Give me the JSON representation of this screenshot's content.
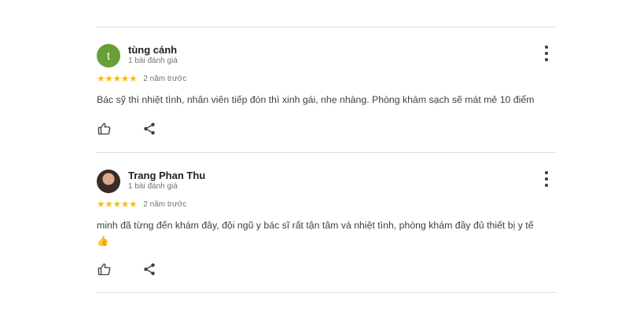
{
  "reviews": [
    {
      "reviewer_name": "tùng cánh",
      "avatar_letter": "t",
      "review_count": "1 bài đánh giá",
      "rating": 5,
      "stars": "★★★★★",
      "time": "2 năm trước",
      "text": "Bác sỹ thì nhiệt tình, nhân viên tiếp đón thì xinh gái, nhẹ nhàng. Phòng khám sạch sẽ mát mẻ 10 điểm",
      "icons": {
        "like": "thumbs-up-icon",
        "share": "share-icon",
        "more": "more-vert-icon"
      }
    },
    {
      "reviewer_name": "Trang Phan Thu",
      "review_count": "1 bài đánh giá",
      "rating": 5,
      "stars": "★★★★★",
      "time": "2 năm trước",
      "text": "minh đã từng đến khám đây, đội ngũ y bác sĩ rất tận tâm và nhiệt tình, phòng khám đầy đủ thiết bị y tế",
      "emoji": "👍",
      "icons": {
        "like": "thumbs-up-icon",
        "share": "share-icon",
        "more": "more-vert-icon"
      }
    }
  ],
  "colors": {
    "star": "#fbbc04",
    "avatar_bg": "#689f38",
    "divider": "#dadce0",
    "muted_text": "#70757a"
  }
}
